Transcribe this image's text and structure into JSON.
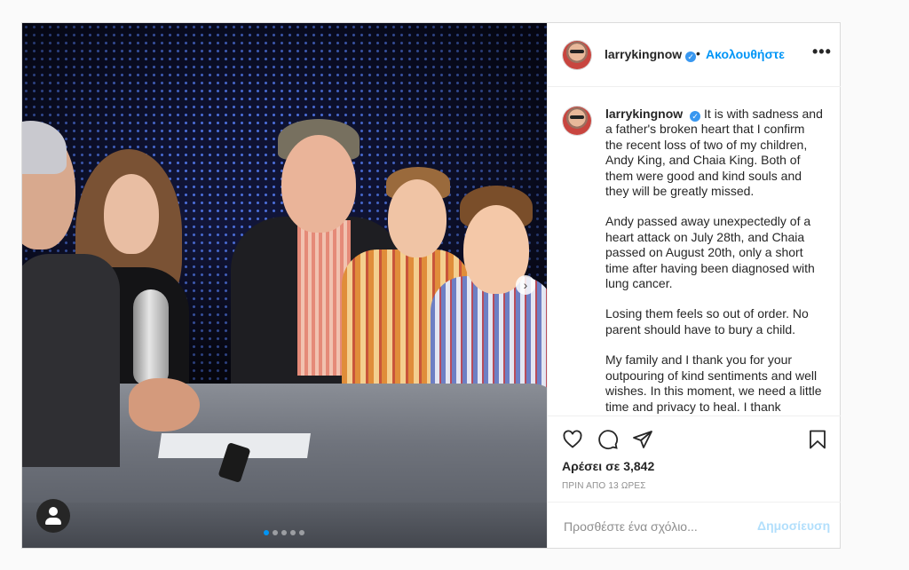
{
  "header": {
    "username": "larrykingnow",
    "verified_icon": "verified-badge-icon",
    "separator": "•",
    "follow_label": "Ακολουθήστε",
    "more_label": "•••"
  },
  "caption": {
    "username": "larrykingnow",
    "paragraphs": [
      "It is with sadness and a father's broken heart that I confirm the recent loss of two of my children, Andy King, and Chaia King. Both of them were good and kind souls and they will be greatly missed.",
      "Andy passed away unexpectedly of a heart attack on July 28th, and Chaia passed on August 20th, only a short time after having been diagnosed with lung cancer.",
      "Losing them feels so out of order. No parent should have to bury a child.",
      "My family and I thank you for your outpouring of kind sentiments and well wishes. In this moment, we need a little time and privacy to heal. I thank"
    ]
  },
  "actions": {
    "like_icon": "heart-icon",
    "comment_icon": "comment-bubble-icon",
    "share_icon": "paper-plane-icon",
    "save_icon": "bookmark-icon",
    "likes_text": "Αρέσει σε 3,842",
    "timestamp": "ΠΡΙΝ ΑΠΟ 13 ΩΡΕΣ"
  },
  "comment": {
    "placeholder": "Προσθέστε ένα σχόλιο...",
    "post_label": "Δημοσίευση"
  },
  "carousel": {
    "current_index": 1,
    "total": 5,
    "next_arrow": "›"
  },
  "colors": {
    "accent": "#0095f6",
    "post_disabled": "#b2dffc",
    "verified": "#3897f0",
    "border": "#dbdbdb"
  }
}
